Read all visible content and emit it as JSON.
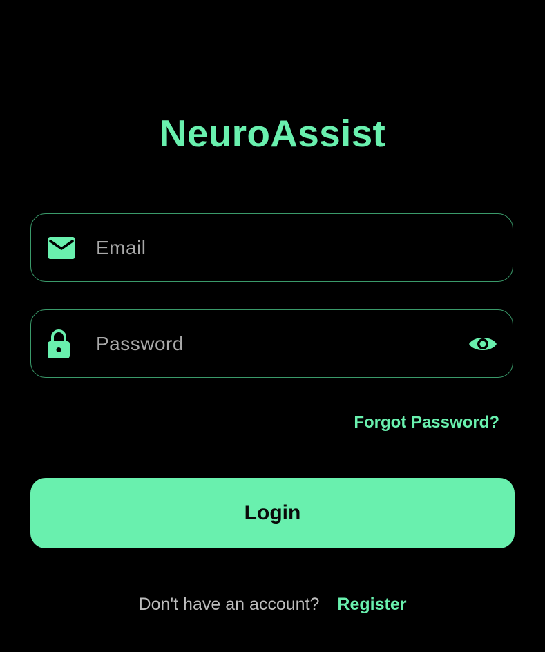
{
  "app": {
    "title": "NeuroAssist"
  },
  "form": {
    "email": {
      "placeholder": "Email",
      "value": "",
      "icon": "mail-icon"
    },
    "password": {
      "placeholder": "Password",
      "value": "",
      "icon": "lock-icon",
      "toggle_icon": "eye-icon"
    },
    "forgot_password_label": "Forgot Password?",
    "login_label": "Login"
  },
  "footer": {
    "question": "Don't have an account?",
    "register_label": "Register"
  },
  "colors": {
    "background": "#000000",
    "accent": "#69f0ae",
    "field_border": "#3a9a6a",
    "placeholder": "#a9a9a9",
    "muted_text": "#bdbdbd",
    "button_text": "#0a0a0a"
  }
}
